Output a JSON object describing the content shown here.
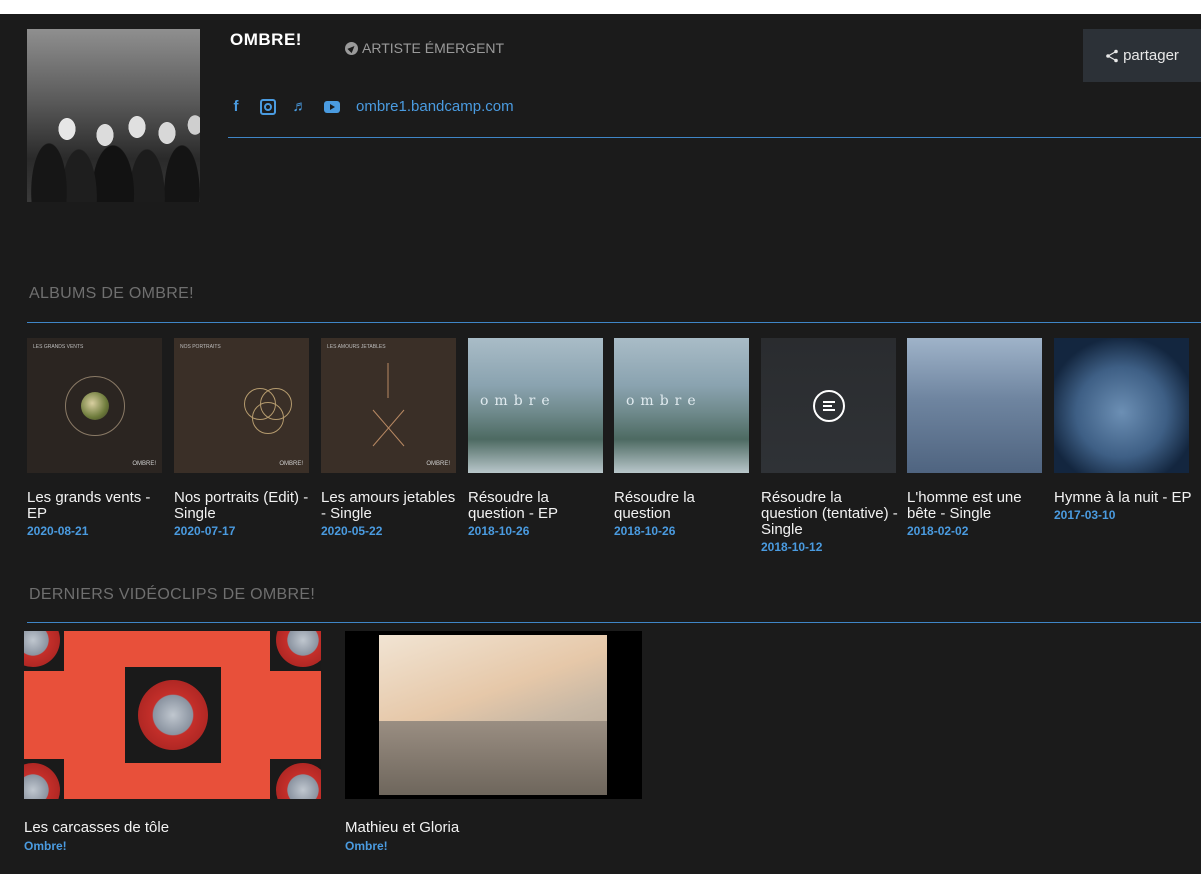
{
  "artist": {
    "name": "OMBRE!",
    "badge": "ARTISTE ÉMERGENT",
    "website": "ombre1.bandcamp.com",
    "share_label": "partager",
    "social_icons": [
      "facebook-icon",
      "instagram-icon",
      "music-note-icon",
      "youtube-icon"
    ]
  },
  "albums_section": {
    "title": "ALBUMS DE OMBRE!",
    "items": [
      {
        "title": "Les grands vents - EP",
        "date": "2020-08-21"
      },
      {
        "title": "Nos portraits (Edit) - Single",
        "date": "2020-07-17"
      },
      {
        "title": "Les amours jetables - Single",
        "date": "2020-05-22"
      },
      {
        "title": "Résoudre la question - EP",
        "date": "2018-10-26"
      },
      {
        "title": "Résoudre la question",
        "date": "2018-10-26"
      },
      {
        "title": "Résoudre la question (tentative) - Single",
        "date": "2018-10-12"
      },
      {
        "title": "L'homme est une bête - Single",
        "date": "2018-02-02"
      },
      {
        "title": "Hymne à la nuit - EP",
        "date": "2017-03-10"
      }
    ]
  },
  "videos_section": {
    "title": "DERNIERS VIDÉOCLIPS DE OMBRE!",
    "items": [
      {
        "title": "Les carcasses de tôle",
        "artist": "Ombre!"
      },
      {
        "title": "Mathieu et Gloria",
        "artist": "Ombre!"
      }
    ]
  },
  "colors": {
    "background": "#1b1b1b",
    "accent": "#4a9be0",
    "share_button": "#2c3137"
  }
}
